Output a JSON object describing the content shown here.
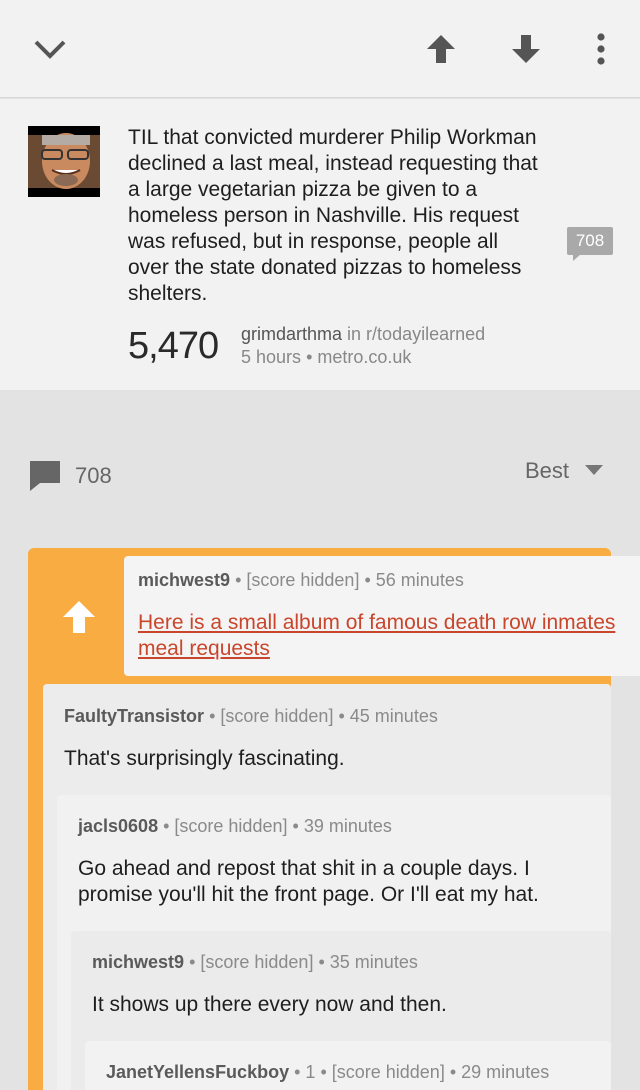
{
  "toolbar": {
    "collapse_icon": "chevron-down-icon",
    "upvote_icon": "arrow-up-icon",
    "downvote_icon": "arrow-down-icon",
    "more_icon": "more-vertical-icon"
  },
  "post": {
    "title": "TIL that convicted murderer Philip Workman declined a last meal, instead requesting that a large vegetarian pizza be given to a homeless person in Nashville. His request was refused, but in response, people all over the state donated pizzas to homeless shelters.",
    "comment_count": "708",
    "score": "5,470",
    "author": "grimdarthma",
    "subreddit_prefix": "in r/todayilearned",
    "time": "5 hours",
    "domain": "metro.co.uk"
  },
  "comments_bar": {
    "count": "708",
    "sort_label": "Best"
  },
  "comments": [
    {
      "author": "michwest9",
      "score": "[score hidden]",
      "time": "56 minutes",
      "body": "Here is a small album of famous death row inmates meal requests"
    },
    {
      "author": "FaultyTransistor",
      "score": "[score hidden]",
      "time": "45 minutes",
      "body": "That's surprisingly fascinating."
    },
    {
      "author": "jacls0608",
      "score": "[score hidden]",
      "time": "39 minutes",
      "body": "Go ahead and repost that shit in a couple days. I promise you'll hit the front page. Or I'll eat my hat."
    },
    {
      "author": "michwest9",
      "score": "[score hidden]",
      "time": "35 minutes",
      "body": "It shows up there every now and then."
    },
    {
      "author": "JanetYellensFuckboy",
      "points": "1",
      "score": "[score hidden]",
      "time": "29 minutes"
    }
  ],
  "colors": {
    "accent_orange": "#f9ac42",
    "link_red": "#c9462c"
  }
}
